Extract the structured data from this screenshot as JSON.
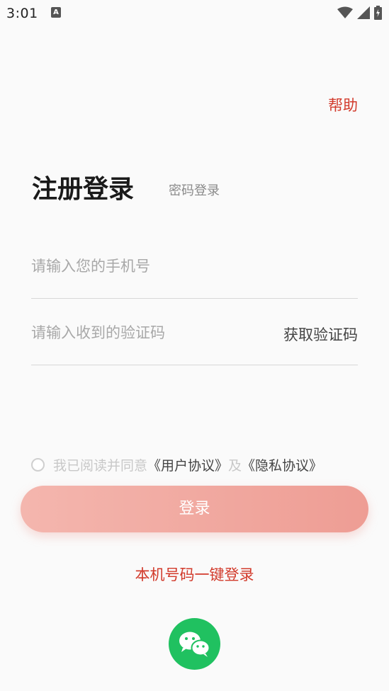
{
  "status_bar": {
    "time": "3:01",
    "notification_icon_letter": "A",
    "icons": [
      "wifi-icon",
      "signal-icon",
      "battery-icon"
    ]
  },
  "header": {
    "help_label": "帮助"
  },
  "title": {
    "main": "注册登录",
    "alt_tab": "密码登录"
  },
  "form": {
    "phone_placeholder": "请输入您的手机号",
    "code_placeholder": "请输入收到的验证码",
    "get_code_label": "获取验证码"
  },
  "agreement": {
    "prefix": "我已阅读并同意",
    "user_agreement": "《用户协议》",
    "connector": "及",
    "privacy_agreement": "《隐私协议》"
  },
  "actions": {
    "login_label": "登录",
    "one_click_label": "本机号码一键登录",
    "wechat_icon": "wechat-icon"
  },
  "colors": {
    "accent": "#d23a2b",
    "button_gradient_start": "#f4b6ae",
    "button_gradient_end": "#ee9d94",
    "wechat_green": "#20c160"
  }
}
